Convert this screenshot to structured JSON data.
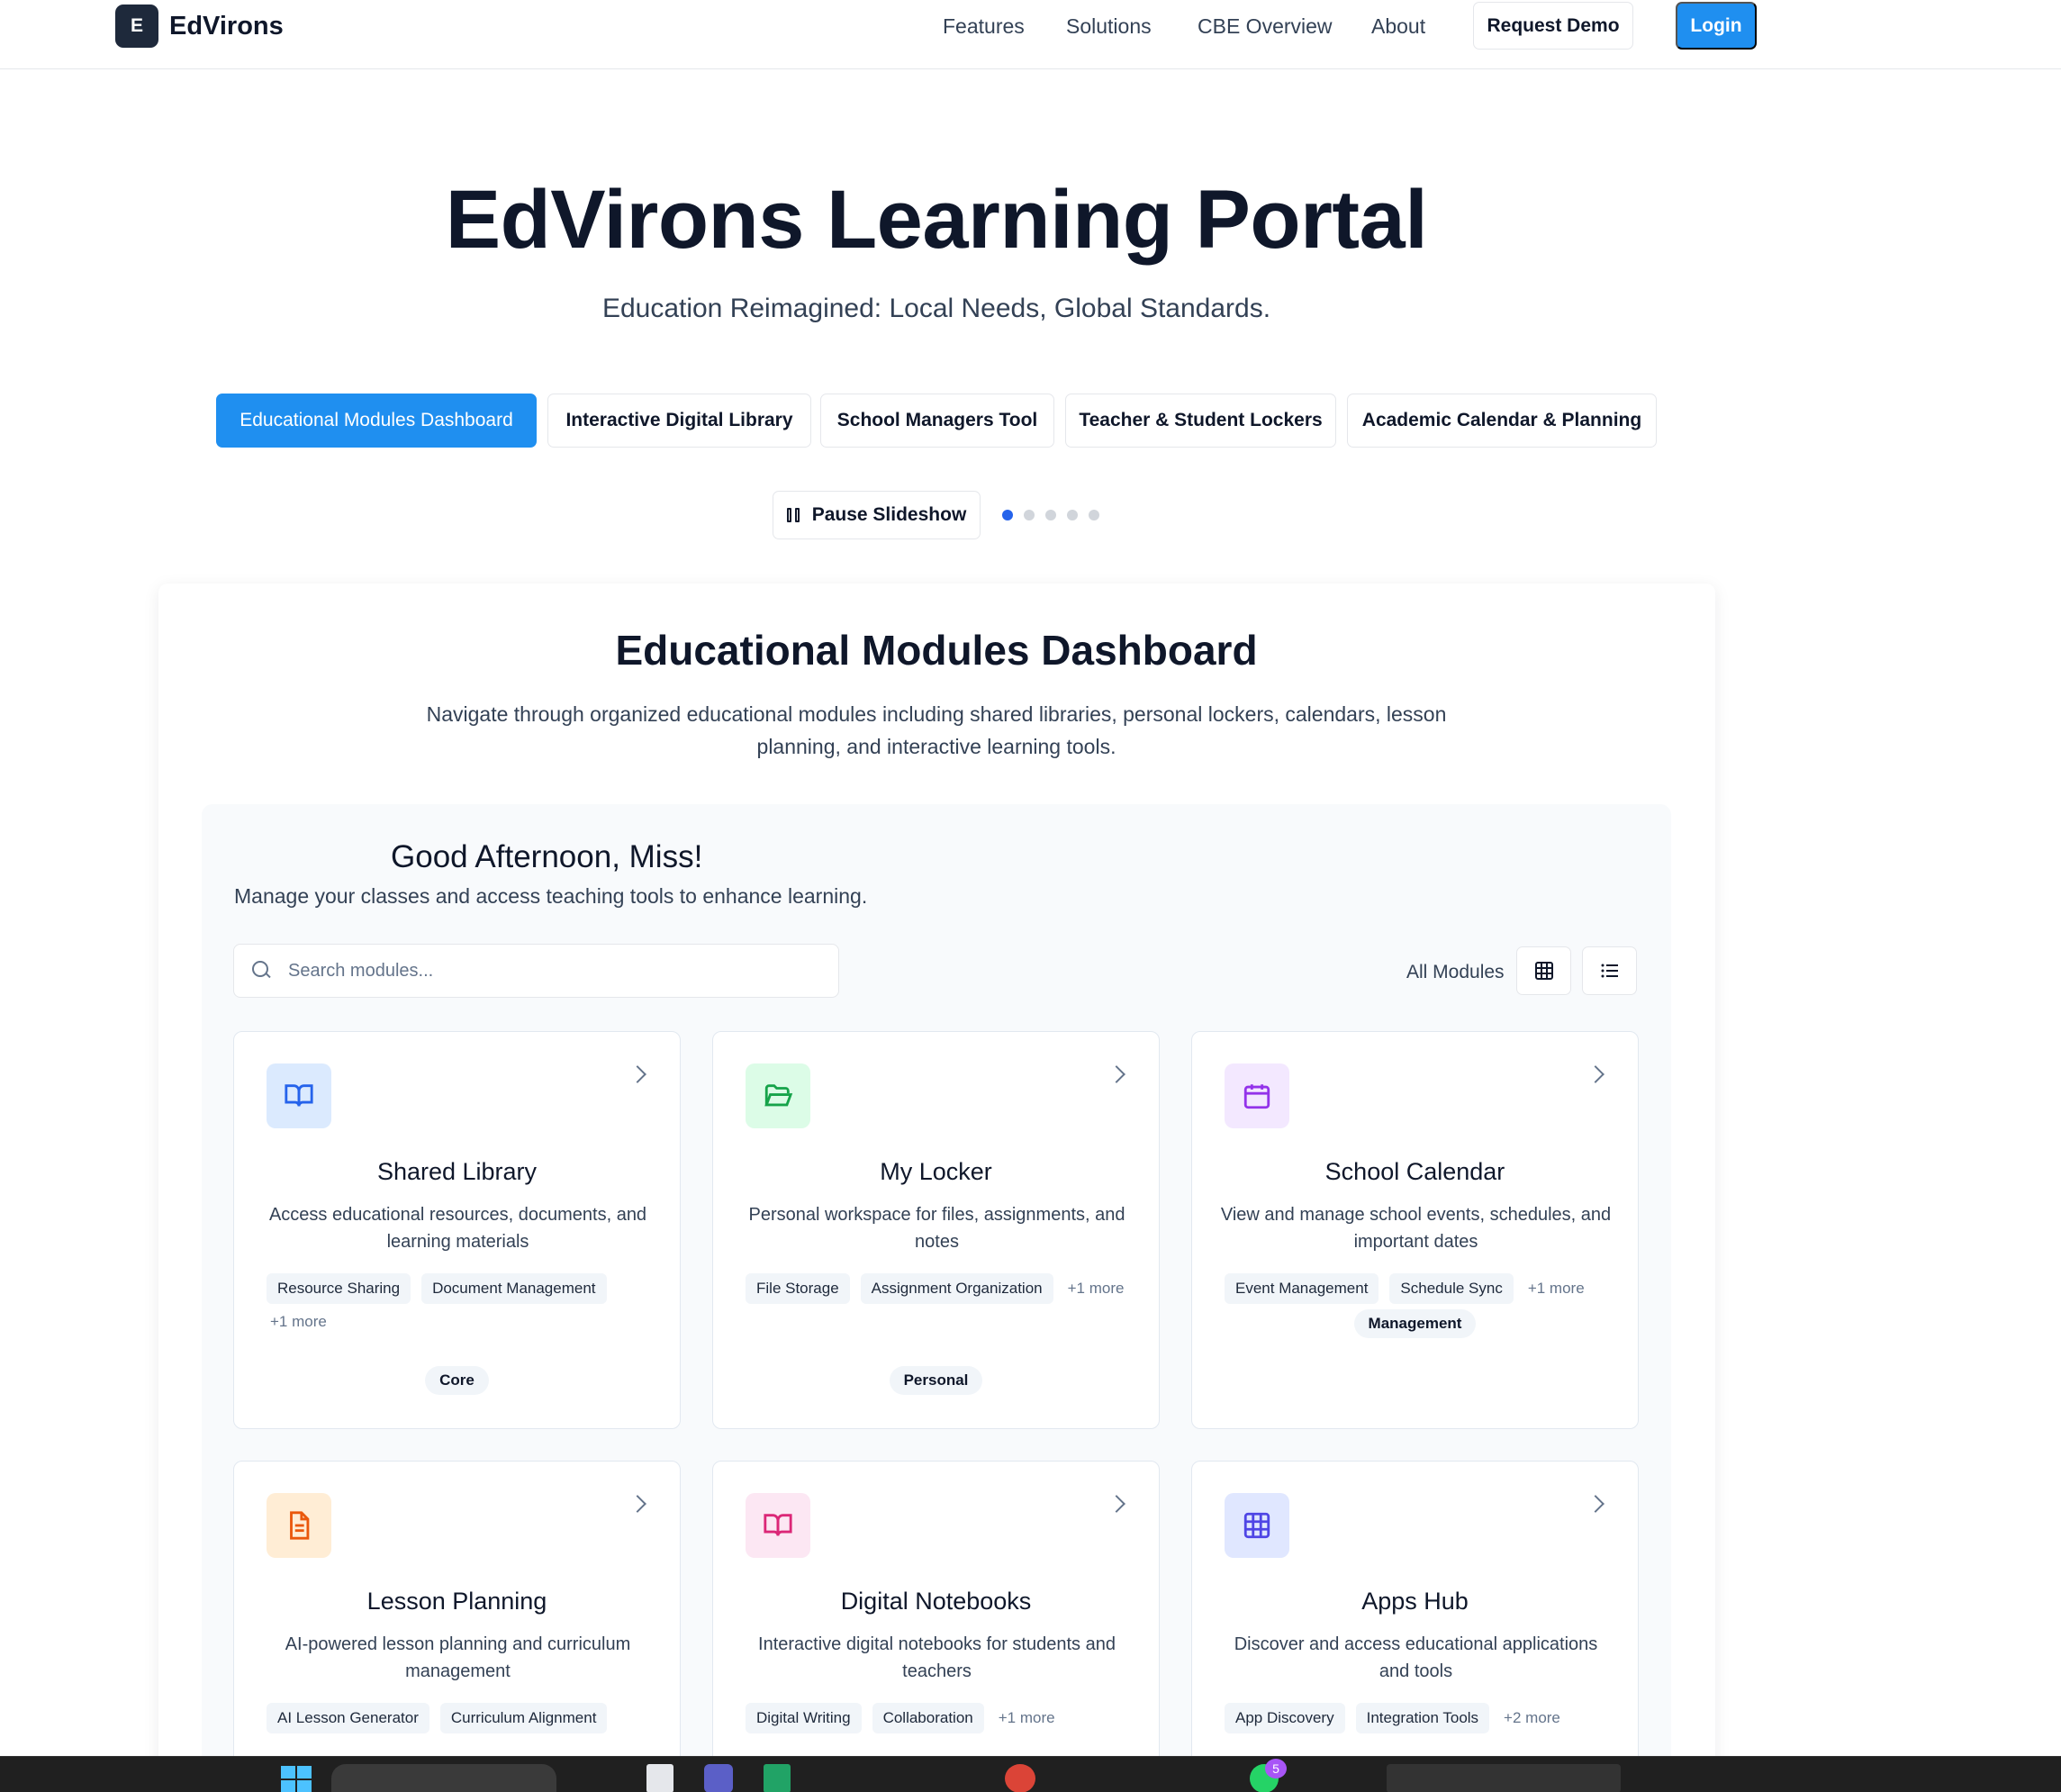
{
  "nav": {
    "logo_letter": "E",
    "brand": "EdVirons",
    "links": [
      "Features",
      "Solutions",
      "CBE Overview",
      "About"
    ],
    "request_demo": "Request Demo",
    "login": "Login"
  },
  "hero": {
    "title": "EdVirons Learning Portal",
    "subtitle": "Education Reimagined: Local Needs, Global Standards."
  },
  "tabs": [
    {
      "label": "Educational Modules Dashboard",
      "active": true
    },
    {
      "label": "Interactive Digital Library",
      "active": false
    },
    {
      "label": "School Managers Tool",
      "active": false
    },
    {
      "label": "Teacher & Student Lockers",
      "active": false
    },
    {
      "label": "Academic Calendar & Planning",
      "active": false
    }
  ],
  "slideshow": {
    "pause_label": "Pause Slideshow",
    "dots": 5,
    "active_dot": 0
  },
  "dashboard": {
    "title": "Educational Modules Dashboard",
    "description": "Navigate through organized educational modules including shared libraries, personal lockers, calendars, lesson planning, and interactive learning tools.",
    "greeting": "Good Afternoon, Miss!",
    "greeting_sub": "Manage your classes and access teaching tools to enhance learning.",
    "search_placeholder": "Search modules...",
    "filter_label": "All Modules"
  },
  "modules": [
    {
      "title": "Shared Library",
      "desc": "Access educational resources, documents, and learning materials",
      "tags": [
        "Resource Sharing",
        "Document Management"
      ],
      "more": "+1 more",
      "badge": "Core",
      "icon": "book-icon",
      "icon_bg": "#dbeafe",
      "icon_color": "#2563eb"
    },
    {
      "title": "My Locker",
      "desc": "Personal workspace for files, assignments, and notes",
      "tags": [
        "File Storage",
        "Assignment Organization"
      ],
      "more": "+1 more",
      "badge": "Personal",
      "icon": "folder-open-icon",
      "icon_bg": "#dcfce7",
      "icon_color": "#16a34a"
    },
    {
      "title": "School Calendar",
      "desc": "View and manage school events, schedules, and important dates",
      "tags": [
        "Event Management",
        "Schedule Sync"
      ],
      "more": "+1 more",
      "badge": "Management",
      "icon": "calendar-icon",
      "icon_bg": "#f3e8ff",
      "icon_color": "#9333ea"
    },
    {
      "title": "Lesson Planning",
      "desc": "AI-powered lesson planning and curriculum management",
      "tags": [
        "AI Lesson Generator",
        "Curriculum Alignment"
      ],
      "more": "",
      "badge": "",
      "icon": "document-icon",
      "icon_bg": "#ffedd5",
      "icon_color": "#ea580c"
    },
    {
      "title": "Digital Notebooks",
      "desc": "Interactive digital notebooks for students and teachers",
      "tags": [
        "Digital Writing",
        "Collaboration"
      ],
      "more": "+1 more",
      "badge": "",
      "icon": "notebook-icon",
      "icon_bg": "#fce7f3",
      "icon_color": "#db2777"
    },
    {
      "title": "Apps Hub",
      "desc": "Discover and access educational applications and tools",
      "tags": [
        "App Discovery",
        "Integration Tools"
      ],
      "more": "+2 more",
      "badge": "",
      "icon": "grid-icon",
      "icon_bg": "#e0e7ff",
      "icon_color": "#4f46e5"
    }
  ],
  "taskbar": {
    "notification_count": "5"
  }
}
